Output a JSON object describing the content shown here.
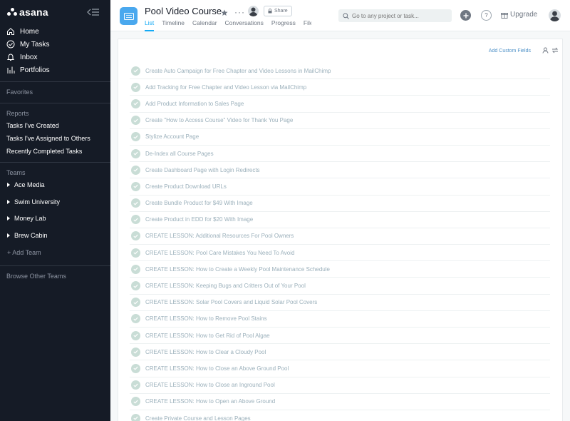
{
  "sidebar": {
    "logo_text": "asana",
    "nav": [
      {
        "label": "Home",
        "icon": "home-icon"
      },
      {
        "label": "My Tasks",
        "icon": "check-circle-icon"
      },
      {
        "label": "Inbox",
        "icon": "bell-icon"
      },
      {
        "label": "Portfolios",
        "icon": "bar-chart-icon"
      }
    ],
    "favorites_label": "Favorites",
    "reports_label": "Reports",
    "reports": [
      "Tasks I've Created",
      "Tasks I've Assigned to Others",
      "Recently Completed Tasks"
    ],
    "teams_label": "Teams",
    "teams": [
      "Ace Media",
      "Swim University",
      "Money Lab",
      "Brew Cabin"
    ],
    "add_team_label": "+ Add Team",
    "browse_teams_label": "Browse Other Teams"
  },
  "header": {
    "project_title": "Pool Video Course",
    "more_label": "···",
    "share_label": "Share",
    "tabs": [
      "List",
      "Timeline",
      "Calendar",
      "Conversations",
      "Progress",
      "Files"
    ],
    "active_tab": "List",
    "search_placeholder": "Go to any project or task...",
    "upgrade_label": "Upgrade",
    "help_label": "?"
  },
  "main": {
    "add_custom_fields_label": "Add Custom Fields",
    "tasks": [
      "Create Auto Campaign for Free Chapter and Video Lessons in MailChimp",
      "Add Tracking for Free Chapter and Video Lesson via MailChimp",
      "Add Product Information to Sales Page",
      "Create \"How to Access Course\" Video for Thank You Page",
      "Stylize Account Page",
      "De-Index all Course Pages",
      "Create Dashboard Page with Login Redirects",
      "Create Product Download URLs",
      "Create Bundle Product for $49 With Image",
      "Create Product in EDD for $20 With Image",
      "CREATE LESSON: Additional Resources For Pool Owners",
      "CREATE LESSON: Pool Care Mistakes You Need To Avoid",
      "CREATE LESSON: How to Create a Weekly Pool Maintenance Schedule",
      "CREATE LESSON: Keeping Bugs and Critters Out of Your Pool",
      "CREATE LESSON: Solar Pool Covers and Liquid Solar Pool Covers",
      "CREATE LESSON: How to Remove Pool Stains",
      "CREATE LESSON: How to Get Rid of Pool Algae",
      "CREATE LESSON: How to Clear a Cloudy Pool",
      "CREATE LESSON: How to Close an Above Ground Pool",
      "CREATE LESSON: How to Close an Inground Pool",
      "CREATE LESSON: How to Open an Above Ground",
      "Create Private Course and Lesson Pages"
    ]
  },
  "colors": {
    "sidebar_bg": "#151b26",
    "accent": "#14aaf5",
    "project_icon": "#4aa8ee",
    "completed_check": "#c9ddd6"
  }
}
